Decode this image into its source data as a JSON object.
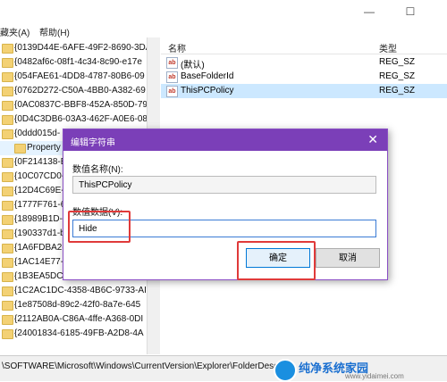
{
  "menu": {
    "favorites": "藏夹(A)",
    "help": "帮助(H)"
  },
  "tree": {
    "items": [
      "{0139D44E-6AFE-49F2-8690-3DA",
      "{0482af6c-08f1-4c34-8c90-e17e",
      "{054FAE61-4DD8-4787-80B6-09",
      "{0762D272-C50A-4BB0-A382-69",
      "{0AC0837C-BBF8-452A-850D-79",
      "{0D4C3DB6-03A3-462F-A0E6-08",
      "{0ddd015d-",
      "Property",
      "{0F214138-B",
      "{10C07CD0-",
      "{12D4C69E-",
      "{1777F761-6",
      "{18989B1D-",
      "{190337d1-b",
      "{1A6FDBA2-",
      "{1AC14E77-0",
      "{1B3EA5DC-B567-4780-B4E1-BE",
      "{1C2AC1DC-4358-4B6C-9733-AI",
      "{1e87508d-89c2-42f0-8a7e-645",
      "{2112AB0A-C86A-4ffe-A368-0DI",
      "{24001834-6185-49FB-A2D8-4A"
    ]
  },
  "list": {
    "headers": {
      "name": "名称",
      "type": "类型"
    },
    "rows": [
      {
        "name": "(默认)",
        "type": "REG_SZ",
        "icon": "ab-icon"
      },
      {
        "name": "BaseFolderId",
        "type": "REG_SZ",
        "icon": "ab-icon"
      },
      {
        "name": "ThisPCPolicy",
        "type": "REG_SZ",
        "icon": "ab-icon"
      }
    ]
  },
  "dialog": {
    "title": "编辑字符串",
    "name_label": "数值名称(N):",
    "name_value": "ThisPCPolicy",
    "data_label": "数值数据(V):",
    "data_value": "Hide",
    "ok": "确定",
    "cancel": "取消"
  },
  "status": {
    "path": "\\SOFTWARE\\Microsoft\\Windows\\CurrentVersion\\Explorer\\FolderDescripti"
  },
  "watermark": {
    "name": "纯净系统家园",
    "url": "www.yidaimei.com"
  },
  "colors": {
    "dialog_title": "#7b3fb8",
    "highlight": "#e03a3a",
    "selection": "#cce8ff"
  }
}
